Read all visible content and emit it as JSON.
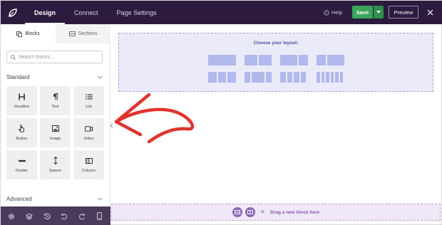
{
  "topbar": {
    "tabs": [
      {
        "label": "Design",
        "active": true
      },
      {
        "label": "Connect",
        "active": false
      },
      {
        "label": "Page Settings",
        "active": false
      }
    ],
    "help_label": "Help",
    "save_label": "Save",
    "preview_label": "Preview"
  },
  "sidebar": {
    "tabs": [
      {
        "label": "Blocks",
        "active": true
      },
      {
        "label": "Sections",
        "active": false
      }
    ],
    "search_placeholder": "Search blocks...",
    "standard_label": "Standard",
    "advanced_label": "Advanced",
    "blocks": [
      {
        "label": "Headline",
        "icon": "headline-icon"
      },
      {
        "label": "Text",
        "icon": "paragraph-icon"
      },
      {
        "label": "List",
        "icon": "list-icon"
      },
      {
        "label": "Button",
        "icon": "pointer-icon"
      },
      {
        "label": "Image",
        "icon": "image-icon"
      },
      {
        "label": "Video",
        "icon": "video-icon"
      },
      {
        "label": "Divider",
        "icon": "divider-icon"
      },
      {
        "label": "Spacer",
        "icon": "spacer-icon"
      },
      {
        "label": "Column",
        "icon": "column-icon"
      }
    ],
    "bottom_icons": [
      "settings-icon",
      "layers-icon",
      "history-icon",
      "undo-icon",
      "redo-icon",
      "mobile-icon"
    ]
  },
  "canvas": {
    "layout_title": "Choose your layout:",
    "drop_or": "or",
    "drop_text": "Drag a new block here"
  },
  "colors": {
    "topbar_bg": "#2c1b3f",
    "save_green": "#3aa65a",
    "layout_bg": "#ebeaf8",
    "layout_block": "#b1b8ec",
    "drop_bg": "#f0e8f7",
    "accent_purple": "#8a5bb5",
    "annotation_red": "#e0342f"
  }
}
